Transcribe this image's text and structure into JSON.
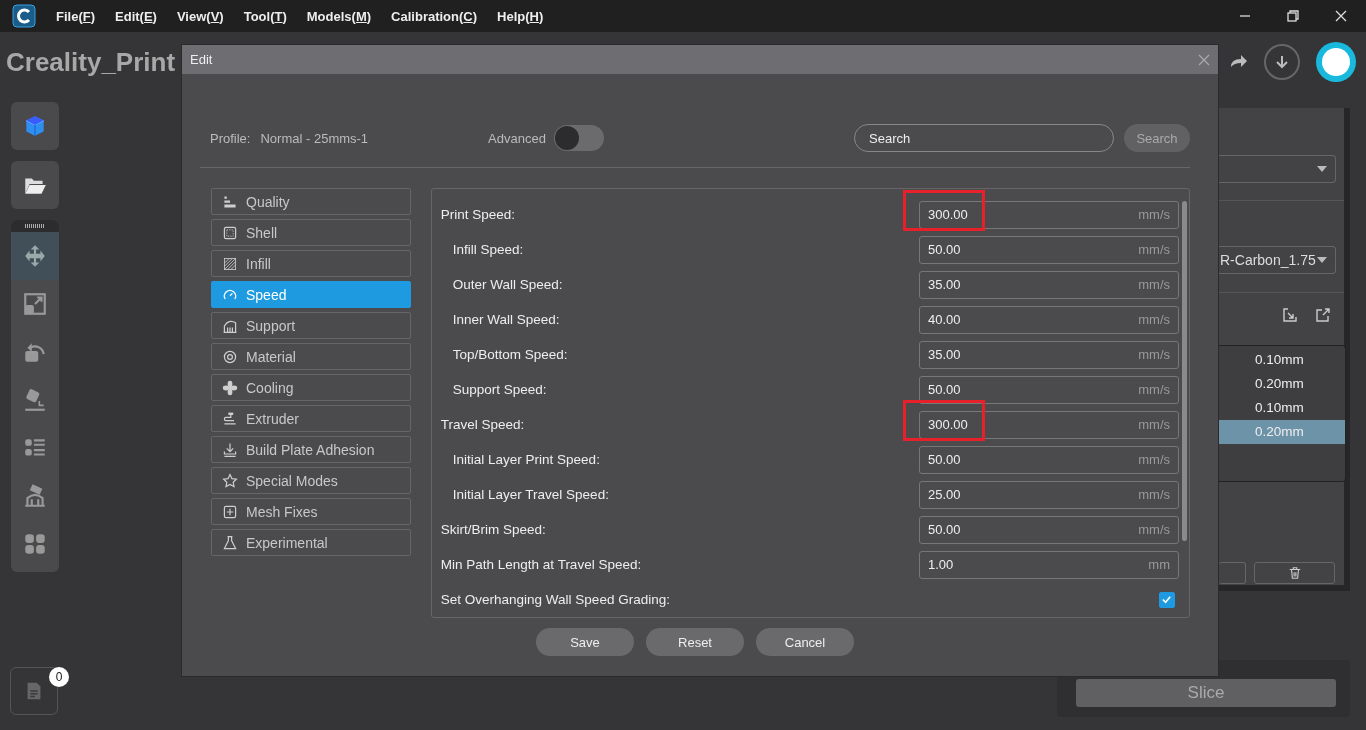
{
  "app": {
    "title": "Creality_Print"
  },
  "menu": [
    {
      "label": "File(F)"
    },
    {
      "label": "Edit(E)"
    },
    {
      "label": "View(V)"
    },
    {
      "label": "Tool(T)"
    },
    {
      "label": "Models(M)"
    },
    {
      "label": "Calibration(C)"
    },
    {
      "label": "Help(H)"
    }
  ],
  "tools": [
    {
      "kind": "move",
      "selected": true
    },
    {
      "kind": "scale",
      "selected": false
    },
    {
      "kind": "rotate",
      "selected": false
    },
    {
      "kind": "lay-flat",
      "selected": false
    },
    {
      "kind": "list",
      "selected": false
    },
    {
      "kind": "support",
      "selected": false
    },
    {
      "kind": "grid",
      "selected": false
    }
  ],
  "file_badge": "0",
  "dialog": {
    "title": "Edit",
    "profile_label": "Profile:",
    "profile_value": "Normal - 25mms-1",
    "advanced": {
      "label": "Advanced",
      "on": false
    },
    "search": {
      "placeholder": "Search",
      "button": "Search"
    },
    "categories": [
      {
        "kind": "quality",
        "label": "Quality",
        "selected": false
      },
      {
        "kind": "shell",
        "label": "Shell",
        "selected": false
      },
      {
        "kind": "infill",
        "label": "Infill",
        "selected": false
      },
      {
        "kind": "speed",
        "label": "Speed",
        "selected": true
      },
      {
        "kind": "support",
        "label": "Support",
        "selected": false
      },
      {
        "kind": "material",
        "label": "Material",
        "selected": false
      },
      {
        "kind": "cooling",
        "label": "Cooling",
        "selected": false
      },
      {
        "kind": "extruder",
        "label": "Extruder",
        "selected": false
      },
      {
        "kind": "adhesion",
        "label": "Build Plate Adhesion",
        "selected": false
      },
      {
        "kind": "special",
        "label": "Special Modes",
        "selected": false
      },
      {
        "kind": "mesh",
        "label": "Mesh Fixes",
        "selected": false
      },
      {
        "kind": "experimental",
        "label": "Experimental",
        "selected": false
      }
    ],
    "settings": [
      {
        "kind": "number",
        "label": "Print Speed:",
        "value": "300.00",
        "unit": "mm/s",
        "highlighted": true,
        "children": [
          {
            "kind": "number",
            "label": "Infill Speed:",
            "value": "50.00",
            "unit": "mm/s",
            "highlighted": false
          },
          {
            "kind": "number",
            "label": "Outer Wall Speed:",
            "value": "35.00",
            "unit": "mm/s",
            "highlighted": false
          },
          {
            "kind": "number",
            "label": "Inner Wall Speed:",
            "value": "40.00",
            "unit": "mm/s",
            "highlighted": false
          },
          {
            "kind": "number",
            "label": "Top/Bottom Speed:",
            "value": "35.00",
            "unit": "mm/s",
            "highlighted": false
          },
          {
            "kind": "number",
            "label": "Support Speed:",
            "value": "50.00",
            "unit": "mm/s",
            "highlighted": false
          }
        ]
      },
      {
        "kind": "number",
        "label": "Travel Speed:",
        "value": "300.00",
        "unit": "mm/s",
        "highlighted": true,
        "children": [
          {
            "kind": "number",
            "label": "Initial Layer Print Speed:",
            "value": "50.00",
            "unit": "mm/s",
            "highlighted": false
          },
          {
            "kind": "number",
            "label": "Initial Layer Travel Speed:",
            "value": "25.00",
            "unit": "mm/s",
            "highlighted": false
          }
        ]
      },
      {
        "kind": "number",
        "label": "Skirt/Brim Speed:",
        "value": "50.00",
        "unit": "mm/s",
        "highlighted": false
      },
      {
        "kind": "number",
        "label": "Min Path Length at Travel Speed:",
        "value": "1.00",
        "unit": "mm",
        "highlighted": false
      },
      {
        "kind": "checkbox",
        "label": "Set Overhanging Wall Speed Grading:",
        "checked": true
      }
    ],
    "buttons": [
      "Save",
      "Reset",
      "Cancel"
    ]
  },
  "right_panel": {
    "material": "R-Carbon_1.75",
    "layer_heights": [
      {
        "value": "0.10mm",
        "selected": false
      },
      {
        "value": "0.20mm",
        "selected": false
      },
      {
        "value": "0.10mm",
        "selected": false
      },
      {
        "value": "0.20mm",
        "selected": true
      }
    ],
    "slice_button": "Slice"
  }
}
